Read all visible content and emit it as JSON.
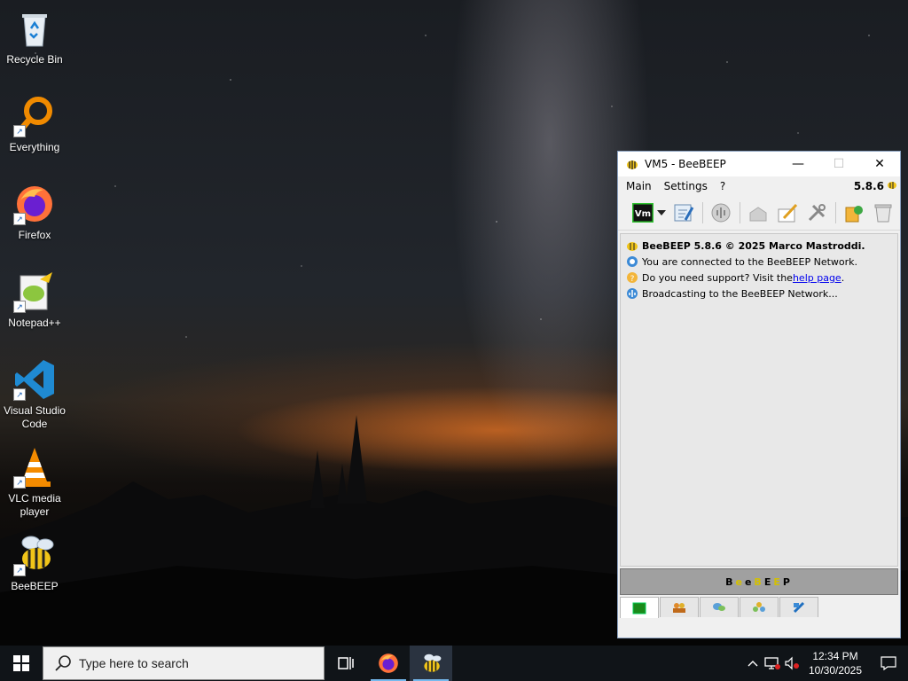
{
  "desktop": {
    "icons": [
      {
        "label": "Recycle Bin",
        "icon": "recycle-bin-icon"
      },
      {
        "label": "Everything",
        "icon": "everything-search-icon"
      },
      {
        "label": "Firefox",
        "icon": "firefox-icon"
      },
      {
        "label": "Notepad++",
        "icon": "notepad-plus-plus-icon"
      },
      {
        "label": "Visual Studio Code",
        "icon": "vscode-icon"
      },
      {
        "label": "VLC media player",
        "icon": "vlc-icon"
      },
      {
        "label": "BeeBEEP",
        "icon": "beebeep-icon"
      }
    ]
  },
  "window": {
    "title": "VM5 - BeeBEEP",
    "controls": {
      "minimize": "—",
      "maximize": "☐",
      "close": "✕"
    },
    "menu": {
      "items": [
        "Main",
        "Settings",
        "?"
      ],
      "version": "5.8.6"
    },
    "toolbar": {
      "buttons": [
        "vm-status-icon",
        "status-dropdown-icon",
        "edit-profile-icon",
        "network-icon",
        "send-file-icon",
        "write-message-icon",
        "tools-icon",
        "share-icon",
        "clear-icon"
      ],
      "vm_label": "Vm"
    },
    "log": {
      "line1": "BeeBEEP 5.8.6 © 2025 Marco Mastroddi.",
      "line2": "You are connected to the BeeBEEP Network.",
      "line3_prefix": "Do you need support? Visit the ",
      "line3_link": "help page",
      "line3_suffix": ".",
      "line4": "Broadcasting to the BeeBEEP Network..."
    },
    "brand": {
      "letters": [
        "B",
        "e",
        "e",
        "B",
        "E",
        "E",
        "P"
      ],
      "colors": [
        "#000000",
        "#d4c000",
        "#000000",
        "#d4c000",
        "#000000",
        "#d4c000",
        "#000000"
      ]
    },
    "tabs": [
      "home-tab",
      "users-tab",
      "chats-tab",
      "groups-tab",
      "files-tab"
    ]
  },
  "taskbar": {
    "search_placeholder": "Type here to search",
    "apps": [
      "task-view-icon",
      "firefox-icon",
      "beebeep-icon"
    ],
    "clock": {
      "time": "12:34 PM",
      "date": "10/30/2025"
    }
  }
}
